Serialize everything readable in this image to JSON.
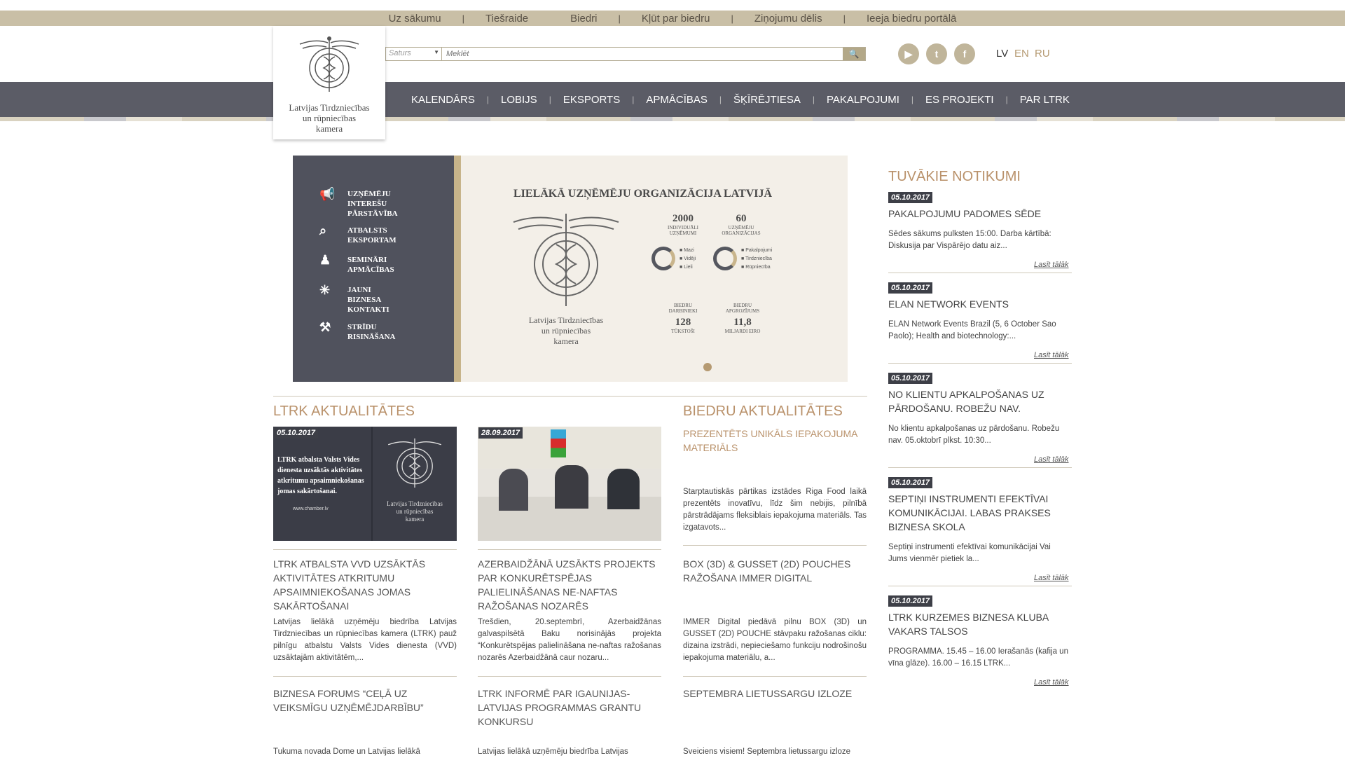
{
  "top_nav": [
    "Uz sākumu",
    "Tiešraide",
    "Biedri",
    "Kļūt par biedru",
    "Ziņojumu dēlis",
    "Ieeja biedru portālā"
  ],
  "logo": {
    "line1": "Latvijas Tirdzniecības",
    "line2": "un rūpniecības",
    "line3": "kamera"
  },
  "search": {
    "category": "Saturs",
    "placeholder": "Meklēt"
  },
  "languages": [
    "LV",
    "EN",
    "RU"
  ],
  "main_nav": [
    "KALENDĀRS",
    "LOBIJS",
    "EKSPORTS",
    "APMĀCĪBAS",
    "ŠĶĪRĒJTIESA",
    "PAKALPOJUMI",
    "ES PROJEKTI",
    "PAR LTRK"
  ],
  "banner": {
    "left_items": [
      [
        "UZŅĒMĒJU",
        "INTEREŠU",
        "PĀRSTĀVĪBA"
      ],
      [
        "ATBALSTS",
        "EKSPORTAM"
      ],
      [
        "SEMINĀRI",
        "APMĀCĪBAS"
      ],
      [
        "JAUNI",
        "BIZNESA",
        "KONTAKTI"
      ],
      [
        "STRĪDU",
        "RISINĀŠANA"
      ]
    ],
    "title": "LIELĀKĀ UZŅĒMĒJU ORGANIZĀCIJA LATVIJĀ",
    "logo_line1": "Latvijas Tirdzniecības",
    "logo_line2": "un rūpniecības",
    "logo_line3": "kamera",
    "stat1_value": "2000",
    "stat1_label1": "INDIVIDUĀLI",
    "stat1_label2": "UZŅĒMUMI",
    "stat2_value": "60",
    "stat2_label1": "UZŅĒMĒJU",
    "stat2_label2": "ORGANIZĀCIJAS",
    "legend1": [
      "Mazi",
      "Vidēji",
      "Lieli"
    ],
    "legend2": [
      "Pakalpojumi",
      "Tirdzniecība",
      "Rūpniecība"
    ],
    "stat3_label1": "BIEDRU",
    "stat3_label2": "DARBINIEKI",
    "stat3_value": "128",
    "stat3_unit": "TŪKSTOŠI",
    "stat4_label1": "BIEDRU",
    "stat4_label2": "APGROZĪJUMS",
    "stat4_value": "11,8",
    "stat4_unit": "MILJARDI EIRO"
  },
  "ltrk_news": {
    "title": "LTRK AKTUALITĀTES",
    "items": [
      {
        "date": "05.10.2017",
        "img_text": "LTRK atbalsta Valsts Vides dienesta uzsāktās aktivitātes atkritumu apsaimniekošanas jomas sakārtošanai.",
        "img_url": "www.chamber.lv",
        "title": "LTRK ATBALSTA VVD UZSĀKTĀS AKTIVITĀTES ATKRITUMU APSAIMNIEKOŠANAS JOMAS SAKĀRTOŠANAI",
        "body": "Latvijas lielākā uzņēmēju biedrība Latvijas Tirdzniecības un rūpniecības kamera (LTRK) pauž pilnīgu atbalstu Valsts Vides dienesta (VVD) uzsāktajām aktivitātēm,..."
      },
      {
        "date": "28.09.2017",
        "title": "AZERBAIDŽĀNĀ UZSĀKTS PROJEKTS PAR KONKURĒTSPĒJAS PALIELINĀŠANAS NE-NAFTAS RAŽOŠANAS NOZARĒS",
        "body": "Trešdien, 20.septembrī, Azerbaidžānas galvaspilsētā Baku norisinājās projekta “Konkurētspējas palielināšana ne-naftas ražošanas nozarēs Azerbaidžānā caur nozaru..."
      }
    ],
    "second_row": [
      {
        "title": "BIZNESA FORUMS “CEĻĀ UZ VEIKSMĪGU UZŅĒMĒJDARBĪBU”",
        "body": "Tukuma novada Dome un Latvijas lielākā"
      },
      {
        "title": "LTRK INFORMĒ PAR IGAUNIJAS-LATVIJAS PROGRAMMAS GRANTU KONKURSU",
        "body": "Latvijas lielākā uzņēmēju biedrība Latvijas"
      }
    ]
  },
  "member_news": {
    "title": "BIEDRU AKTUALITĀTES",
    "items": [
      {
        "title": "PREZENTĒTS UNIKĀLS IEPAKOJUMA MATERIĀLS",
        "body": "Starptautiskās pārtikas izstādes Riga Food laikā prezentēts inovatīvu, līdz šim nebijis, pilnībā pārstrādājams fleksiblais iepakojuma materiāls. Tas izgatavots..."
      },
      {
        "title": "BOX (3D) & GUSSET (2D) POUCHES RAŽOŠANA IMMER DIGITAL",
        "body": "IMMER Digital piedāvā pilnu BOX (3D) un GUSSET (2D) POUCHE stāvpaku ražošanas ciklu: dizaina izstrādi, nepieciešamo funkciju nodrošinošu iepakojuma materiālu, a..."
      },
      {
        "title": "SEPTEMBRA LIETUSSARGU IZLOZE",
        "body": "Sveiciens visiem! Septembra lietussargu izloze"
      }
    ]
  },
  "events": {
    "title": "TUVĀKIE NOTIKUMI",
    "more_label": "Lasīt tālāk",
    "items": [
      {
        "date": "05.10.2017",
        "title": "PAKALPOJUMU PADOMES SĒDE",
        "body": "Sēdes sākums pulksten 15:00.   Darba kārtībā: Diskusija par Vispārējo datu aiz..."
      },
      {
        "date": "05.10.2017",
        "title": "ELAN NETWORK EVENTS",
        "body": "ELAN Network Events Brazil (5, 6 October Sao Paolo); Health and biotechnology:..."
      },
      {
        "date": "05.10.2017",
        "title": "NO KLIENTU APKALPOŠANAS UZ PĀRDOŠANU. ROBEŽU NAV.",
        "body": "    No klientu apkalpošanas uz pārdošanu. Robežu nav. 05.oktobrī plkst. 10:30..."
      },
      {
        "date": "05.10.2017",
        "title": "SEPTIŅI INSTRUMENTI EFEKTĪVAI KOMUNIKĀCIJAI. LABAS PRAKSES BIZNESA SKOLA",
        "body": "Septiņi instrumenti efektīvai komunikācijai Vai Jums vienmēr pietiek la..."
      },
      {
        "date": "05.10.2017",
        "title": "LTRK KURZEMES BIZNESA KLUBA VAKARS TALSOS",
        "body": "PROGRAMMA. 15.45 – 16.00 Ierašanās (kafija un vīna glāze). 16.00 – 16.15 LTRK..."
      }
    ]
  },
  "colors": {
    "topbar": "#c9bfa6",
    "navbar": "#5b5c66",
    "accent": "#b9916a",
    "date_badge": "#3d3f47"
  }
}
